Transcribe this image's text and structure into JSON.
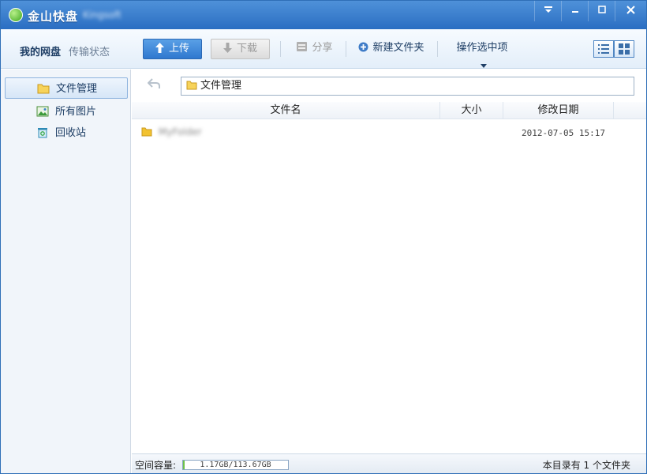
{
  "titlebar": {
    "app_name": "金山快盘",
    "username": "Kingsoft"
  },
  "toolbar": {
    "tab_mydisk": "我的网盘",
    "tab_transfer": "传输状态",
    "upload": "上传",
    "download": "下载",
    "share": "分享",
    "new_folder": "新建文件夹",
    "selection_ops": "操作选中项"
  },
  "sidebar": {
    "items": [
      {
        "label": "文件管理",
        "icon": "folder-icon",
        "active": true
      },
      {
        "label": "所有图片",
        "icon": "picture-icon",
        "active": false
      },
      {
        "label": "回收站",
        "icon": "recycle-bin-icon",
        "active": false
      }
    ]
  },
  "address": {
    "path": "文件管理"
  },
  "columns": {
    "name": "文件名",
    "size": "大小",
    "modified": "修改日期"
  },
  "files": [
    {
      "name": "MyFolder",
      "size": "",
      "modified": "2012-07-05 15:17"
    }
  ],
  "status": {
    "space_label": "空间容量:",
    "space_usage": "1.17GB/113.67GB",
    "space_fraction": 0.0103,
    "dir_count": "本目录有 1 个文件夹"
  },
  "colors": {
    "accent": "#2f78cf",
    "titlebar": "#3d80d0",
    "folder": "#f2c230"
  }
}
